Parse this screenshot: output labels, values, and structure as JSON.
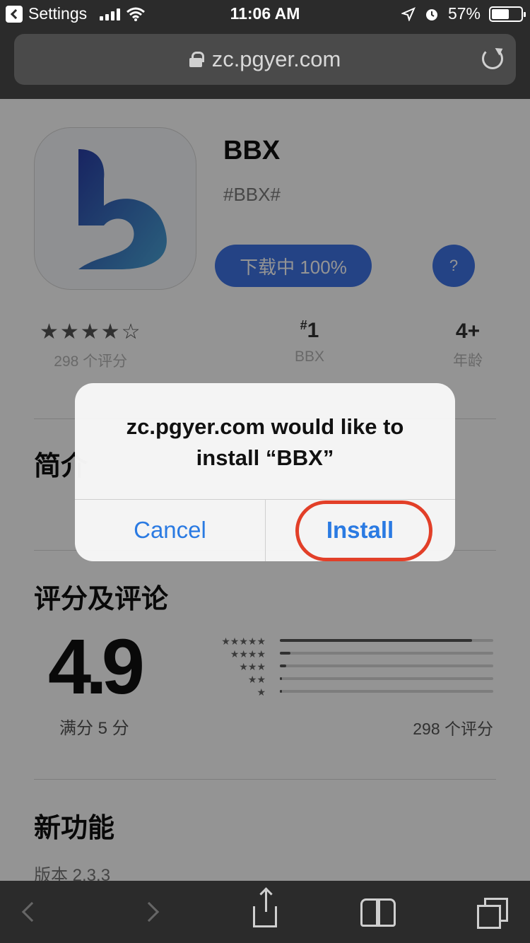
{
  "status_bar": {
    "back_app": "Settings",
    "time": "11:06 AM",
    "battery_percent": "57%"
  },
  "browser": {
    "url": "zc.pgyer.com"
  },
  "app": {
    "name": "BBX",
    "subtitle": "#BBX#",
    "download_label": "下载中 100%",
    "help_label": "?"
  },
  "stats": {
    "stars": "★★★★☆",
    "ratings_count": "298 个评分",
    "rank": "1",
    "rank_category": "BBX",
    "age": "4+",
    "age_label": "年龄"
  },
  "sections": {
    "intro_title": "简介",
    "ratings_title": "评分及评论",
    "new_features_title": "新功能",
    "version": "版本 2.3.3"
  },
  "ratings": {
    "average": "4.9",
    "out_of": "满分 5 分",
    "total": "298 个评分",
    "star_labels": [
      "★★★★★",
      "★★★★",
      "★★★",
      "★★",
      "★"
    ],
    "distribution": [
      0.9,
      0.05,
      0.03,
      0.01,
      0.01
    ]
  },
  "alert": {
    "title": "zc.pgyer.com would like to install “BBX”",
    "cancel": "Cancel",
    "install": "Install"
  },
  "colors": {
    "accent_blue": "#3f74e6",
    "ios_blue": "#2a7ae2",
    "highlight_red": "#e23f28"
  }
}
